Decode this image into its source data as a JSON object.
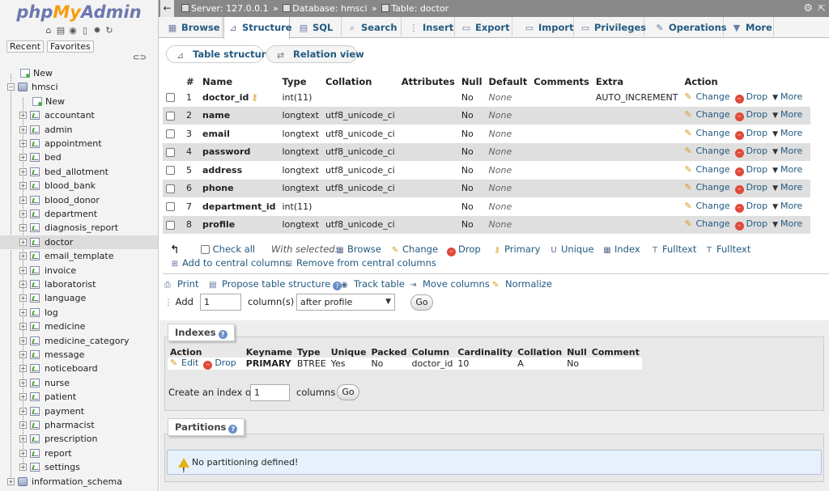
{
  "colors": {
    "link": "#235a81",
    "drop_red": "#e04a3b",
    "topbar_gray": "#888888",
    "logo_php": "#6c78af",
    "logo_my": "#f89c0e"
  },
  "nav": {
    "logo": {
      "php": "php",
      "my": "My",
      "admin": "Admin"
    },
    "icons": [
      "home-icon",
      "sql-icon",
      "logout-icon",
      "docs-icon",
      "settings-icon",
      "reload-icon"
    ],
    "tabs": {
      "recent": "Recent",
      "favorites": "Favorites"
    },
    "new_label": "New",
    "db_name": "hmsci",
    "db_new_label": "New",
    "tables": [
      "accountant",
      "admin",
      "appointment",
      "bed",
      "bed_allotment",
      "blood_bank",
      "blood_donor",
      "department",
      "diagnosis_report",
      "doctor",
      "email_template",
      "invoice",
      "laboratorist",
      "language",
      "log",
      "medicine",
      "medicine_category",
      "message",
      "noticeboard",
      "nurse",
      "patient",
      "payment",
      "pharmacist",
      "prescription",
      "report",
      "settings"
    ],
    "selected_table": "doctor",
    "last_db": "information_schema"
  },
  "breadcrumb": {
    "server": "Server: 127.0.0.1",
    "sep1": "»",
    "database": "Database: hmsci",
    "sep2": "»",
    "table": "Table: doctor"
  },
  "menu": {
    "tabs": [
      {
        "label": "Browse",
        "icon": "browse-icon"
      },
      {
        "label": "Structure",
        "icon": "structure-icon"
      },
      {
        "label": "SQL",
        "icon": "sql-icon"
      },
      {
        "label": "Search",
        "icon": "search-icon"
      },
      {
        "label": "Insert",
        "icon": "insert-icon"
      },
      {
        "label": "Export",
        "icon": "export-icon"
      },
      {
        "label": "Import",
        "icon": "import-icon"
      },
      {
        "label": "Privileges",
        "icon": "privileges-icon"
      },
      {
        "label": "Operations",
        "icon": "operations-icon"
      },
      {
        "label": "More",
        "icon": "more-icon"
      }
    ],
    "active": "Structure"
  },
  "subtabs": {
    "table_structure": "Table structure",
    "relation_view": "Relation view"
  },
  "structure": {
    "headers": {
      "num": "#",
      "name": "Name",
      "type": "Type",
      "collation": "Collation",
      "attributes": "Attributes",
      "null": "Null",
      "default": "Default",
      "comments": "Comments",
      "extra": "Extra",
      "action": "Action"
    },
    "rows": [
      {
        "num": "1",
        "name": "doctor_id",
        "type": "int(11)",
        "collation": "",
        "null": "No",
        "default": "None",
        "extra": "AUTO_INCREMENT",
        "primary": true
      },
      {
        "num": "2",
        "name": "name",
        "type": "longtext",
        "collation": "utf8_unicode_ci",
        "null": "No",
        "default": "None",
        "extra": ""
      },
      {
        "num": "3",
        "name": "email",
        "type": "longtext",
        "collation": "utf8_unicode_ci",
        "null": "No",
        "default": "None",
        "extra": ""
      },
      {
        "num": "4",
        "name": "password",
        "type": "longtext",
        "collation": "utf8_unicode_ci",
        "null": "No",
        "default": "None",
        "extra": ""
      },
      {
        "num": "5",
        "name": "address",
        "type": "longtext",
        "collation": "utf8_unicode_ci",
        "null": "No",
        "default": "None",
        "extra": ""
      },
      {
        "num": "6",
        "name": "phone",
        "type": "longtext",
        "collation": "utf8_unicode_ci",
        "null": "No",
        "default": "None",
        "extra": ""
      },
      {
        "num": "7",
        "name": "department_id",
        "type": "int(11)",
        "collation": "",
        "null": "No",
        "default": "None",
        "extra": ""
      },
      {
        "num": "8",
        "name": "profile",
        "type": "longtext",
        "collation": "utf8_unicode_ci",
        "null": "No",
        "default": "None",
        "extra": ""
      }
    ],
    "actions": {
      "change": "Change",
      "drop": "Drop",
      "more": "More"
    }
  },
  "with_selected": {
    "check_all": "Check all",
    "label": "With selected:",
    "actions": [
      "Browse",
      "Change",
      "Drop",
      "Primary",
      "Unique",
      "Index",
      "Fulltext",
      "Fulltext"
    ],
    "add_central": "Add to central columns",
    "remove_central": "Remove from central columns"
  },
  "tools": {
    "print": "Print",
    "propose": "Propose table structure",
    "track": "Track table",
    "move": "Move columns",
    "normalize": "Normalize"
  },
  "add_columns": {
    "label": "Add",
    "value": "1",
    "suffix": "column(s)",
    "position": "after profile",
    "go": "Go"
  },
  "indexes": {
    "legend": "Indexes",
    "headers": [
      "Action",
      "Keyname",
      "Type",
      "Unique",
      "Packed",
      "Column",
      "Cardinality",
      "Collation",
      "Null",
      "Comment"
    ],
    "row": {
      "edit": "Edit",
      "drop": "Drop",
      "keyname": "PRIMARY",
      "type": "BTREE",
      "unique": "Yes",
      "packed": "No",
      "column": "doctor_id",
      "cardinality": "10",
      "collation": "A",
      "null": "No",
      "comment": ""
    },
    "create_label": "Create an index on",
    "create_value": "1",
    "create_suffix": "columns",
    "go": "Go"
  },
  "partitions": {
    "legend": "Partitions",
    "message": "No partitioning defined!"
  }
}
